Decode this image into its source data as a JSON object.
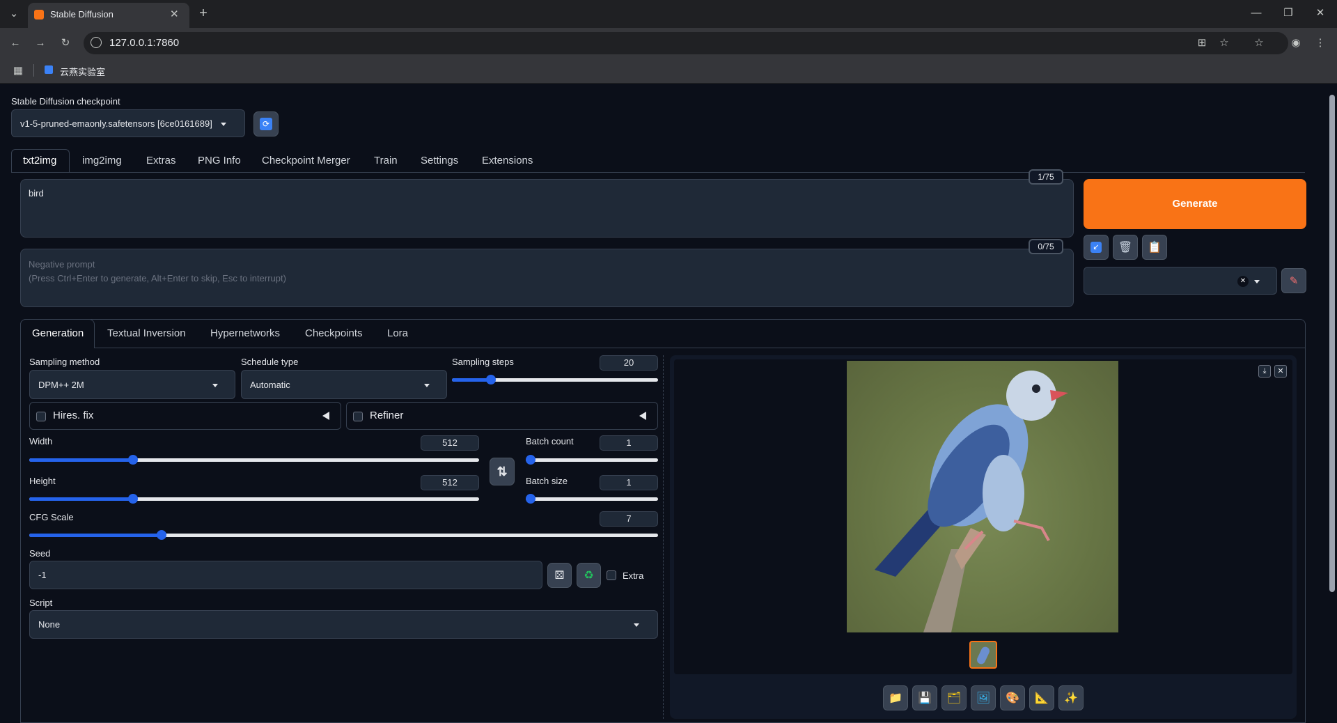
{
  "browser": {
    "tab_title": "Stable Diffusion",
    "url": "127.0.0.1:7860",
    "bookmark": "云燕实验室"
  },
  "checkpoint": {
    "label": "Stable Diffusion checkpoint",
    "value": "v1-5-pruned-emaonly.safetensors [6ce0161689]"
  },
  "main_tabs": [
    "txt2img",
    "img2img",
    "Extras",
    "PNG Info",
    "Checkpoint Merger",
    "Train",
    "Settings",
    "Extensions"
  ],
  "prompt": {
    "value": "bird",
    "counter": "1/75"
  },
  "negative_prompt": {
    "placeholder": "Negative prompt\n(Press Ctrl+Enter to generate, Alt+Enter to skip, Esc to interrupt)",
    "counter": "0/75"
  },
  "generate_label": "Generate",
  "sub_tabs": [
    "Generation",
    "Textual Inversion",
    "Hypernetworks",
    "Checkpoints",
    "Lora"
  ],
  "sampling_method": {
    "label": "Sampling method",
    "value": "DPM++ 2M"
  },
  "schedule_type": {
    "label": "Schedule type",
    "value": "Automatic"
  },
  "sampling_steps": {
    "label": "Sampling steps",
    "value": "20",
    "fraction": 0.19
  },
  "hires_fix": {
    "label": "Hires. fix"
  },
  "refiner": {
    "label": "Refiner"
  },
  "width": {
    "label": "Width",
    "value": "512",
    "fraction": 0.23
  },
  "height": {
    "label": "Height",
    "value": "512",
    "fraction": 0.23
  },
  "batch_count": {
    "label": "Batch count",
    "value": "1",
    "fraction": 0.0
  },
  "batch_size": {
    "label": "Batch size",
    "value": "1",
    "fraction": 0.0
  },
  "cfg_scale": {
    "label": "CFG Scale",
    "value": "7",
    "fraction": 0.21
  },
  "seed": {
    "label": "Seed",
    "value": "-1",
    "extra_label": "Extra"
  },
  "script": {
    "label": "Script",
    "value": "None"
  },
  "colors": {
    "accent": "#2563eb",
    "generate": "#f97316",
    "bg": "#0b0f19"
  }
}
